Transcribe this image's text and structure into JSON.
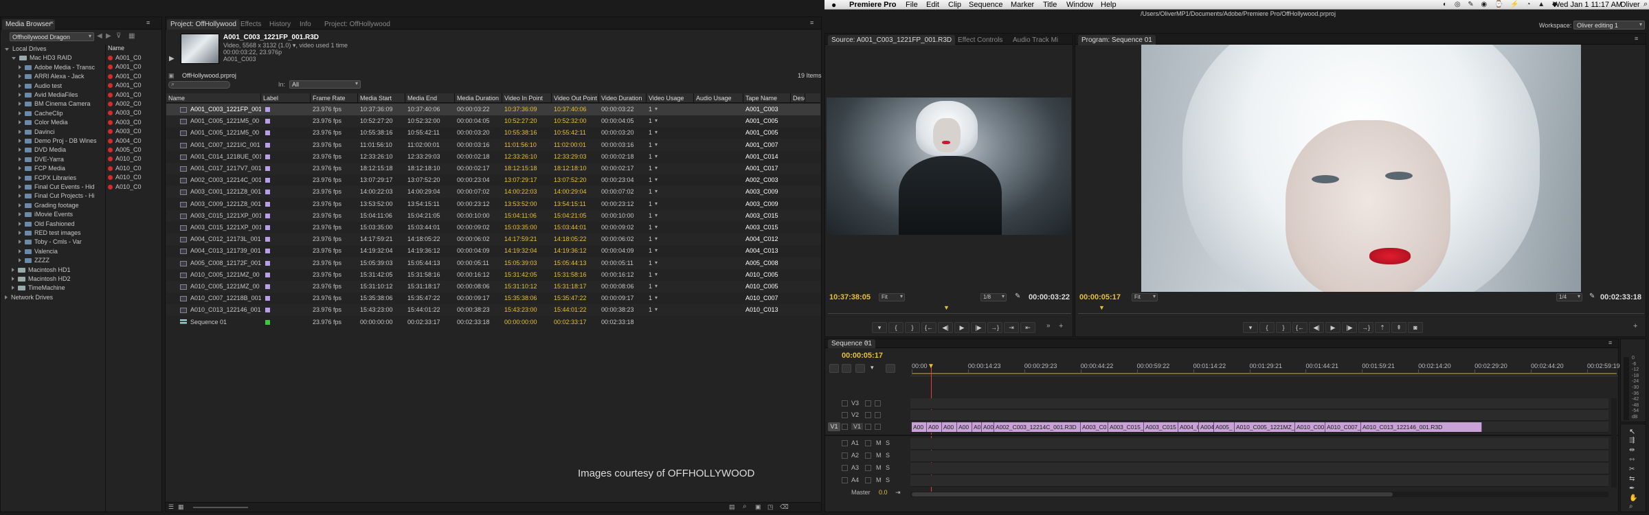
{
  "menubar": {
    "app_name": "Premiere Pro",
    "menus": [
      "File",
      "Edit",
      "Clip",
      "Sequence",
      "Marker",
      "Title",
      "Window",
      "Help"
    ],
    "clock": "Wed Jan 1  11:17 AM",
    "user": "Oliver",
    "path": "/Users/OliverMP1/Documents/Adobe/Premiere Pro/OffHollywood.prproj"
  },
  "workspace": {
    "label": "Workspace:",
    "value": "Oliver editing 1"
  },
  "media_browser": {
    "tab": "Media Browser",
    "location": "Offhollywood Dragon",
    "name_header": "Name",
    "tree": [
      {
        "label": "Local Drives",
        "type": "root",
        "level": 0,
        "open": true
      },
      {
        "label": "Mac HD3 RAID",
        "type": "drive",
        "level": 1,
        "open": true
      },
      {
        "label": "Adobe Media - Transc",
        "type": "folder",
        "level": 2
      },
      {
        "label": "ARRI Alexa - Jack",
        "type": "folder",
        "level": 2
      },
      {
        "label": "Audio test",
        "type": "folder",
        "level": 2
      },
      {
        "label": "Avid MediaFiles",
        "type": "folder",
        "level": 2
      },
      {
        "label": "BM Cinema Camera",
        "type": "folder",
        "level": 2
      },
      {
        "label": "CacheClip",
        "type": "folder",
        "level": 2
      },
      {
        "label": "Color Media",
        "type": "folder",
        "level": 2
      },
      {
        "label": "Davinci",
        "type": "folder",
        "level": 2
      },
      {
        "label": "Demo Proj - DB Wines",
        "type": "folder",
        "level": 2
      },
      {
        "label": "DVD Media",
        "type": "folder",
        "level": 2
      },
      {
        "label": "DVE-Yarra",
        "type": "folder",
        "level": 2
      },
      {
        "label": "FCP Media",
        "type": "folder",
        "level": 2
      },
      {
        "label": "FCPX Libraries",
        "type": "folder",
        "level": 2
      },
      {
        "label": "Final Cut Events - Hid",
        "type": "folder",
        "level": 2
      },
      {
        "label": "Final Cut Projects - Hi",
        "type": "folder",
        "level": 2
      },
      {
        "label": "Grading footage",
        "type": "folder",
        "level": 2
      },
      {
        "label": "iMovie Events",
        "type": "folder",
        "level": 2
      },
      {
        "label": "Old Fashioned",
        "type": "folder",
        "level": 2
      },
      {
        "label": "RED test images",
        "type": "folder",
        "level": 2
      },
      {
        "label": "Toby - Cmls - Var",
        "type": "folder",
        "level": 2
      },
      {
        "label": "Valencia",
        "type": "folder",
        "level": 2
      },
      {
        "label": "ZZZZ",
        "type": "folder",
        "level": 2
      },
      {
        "label": "Macintosh HD1",
        "type": "drive",
        "level": 1
      },
      {
        "label": "Macintosh HD2",
        "type": "drive",
        "level": 1
      },
      {
        "label": "TimeMachine",
        "type": "drive",
        "level": 1
      },
      {
        "label": "Network Drives",
        "type": "root",
        "level": 0
      }
    ],
    "files": [
      "A001_C0",
      "A001_C0",
      "A001_C0",
      "A001_C0",
      "A001_C0",
      "A002_C0",
      "A003_C0",
      "A003_C0",
      "A003_C0",
      "A004_C0",
      "A005_C0",
      "A010_C0",
      "A010_C0",
      "A010_C0",
      "A010_C0"
    ]
  },
  "project": {
    "tabs": [
      "Project: OffHollywood",
      "Effects",
      "History",
      "Info",
      "Project: OffHollywood"
    ],
    "clip_name": "A001_C003_1221FP_001.R3D",
    "clip_info1": "Video, 5568 x 3132 (1.0)",
    "clip_info1b": ", video used 1 time",
    "clip_info2": "00:00:03:22, 23.976p",
    "clip_info3": "A001_C003",
    "project_file": "OffHollywood.prproj",
    "item_count": "19 Items",
    "in_label": "In:",
    "in_value": "All",
    "columns": [
      "Name",
      "Label",
      "Frame Rate",
      "Media Start",
      "Media End",
      "Media Duration",
      "Video In Point",
      "Video Out Point",
      "Video Duration",
      "Video Usage",
      "Audio Usage",
      "Tape Name",
      "Desc"
    ],
    "rows": [
      {
        "name": "A001_C003_1221FP_001",
        "label": "#b9a0e6",
        "rate": "23.976 fps",
        "mstart": "10:37:36:09",
        "mend": "10:37:40:06",
        "mdur": "00:00:03:22",
        "vin": "10:37:36:09",
        "vout": "10:37:40:06",
        "vdur": "00:00:03:22",
        "usage": "1",
        "tape": "A001_C003"
      },
      {
        "name": "A001_C005_1221M5_00",
        "label": "#b9a0e6",
        "rate": "23.976 fps",
        "mstart": "10:52:27:20",
        "mend": "10:52:32:00",
        "mdur": "00:00:04:05",
        "vin": "10:52:27:20",
        "vout": "10:52:32:00",
        "vdur": "00:00:04:05",
        "usage": "1",
        "tape": "A001_C005"
      },
      {
        "name": "A001_C005_1221M5_00",
        "label": "#b9a0e6",
        "rate": "23.976 fps",
        "mstart": "10:55:38:16",
        "mend": "10:55:42:11",
        "mdur": "00:00:03:20",
        "vin": "10:55:38:16",
        "vout": "10:55:42:11",
        "vdur": "00:00:03:20",
        "usage": "1",
        "tape": "A001_C005"
      },
      {
        "name": "A001_C007_1221IC_001",
        "label": "#b9a0e6",
        "rate": "23.976 fps",
        "mstart": "11:01:56:10",
        "mend": "11:02:00:01",
        "mdur": "00:00:03:16",
        "vin": "11:01:56:10",
        "vout": "11:02:00:01",
        "vdur": "00:00:03:16",
        "usage": "1",
        "tape": "A001_C007"
      },
      {
        "name": "A001_C014_1218UE_001",
        "label": "#b9a0e6",
        "rate": "23.976 fps",
        "mstart": "12:33:26:10",
        "mend": "12:33:29:03",
        "mdur": "00:00:02:18",
        "vin": "12:33:26:10",
        "vout": "12:33:29:03",
        "vdur": "00:00:02:18",
        "usage": "1",
        "tape": "A001_C014"
      },
      {
        "name": "A001_C017_1217V7_001",
        "label": "#b9a0e6",
        "rate": "23.976 fps",
        "mstart": "18:12:15:18",
        "mend": "18:12:18:10",
        "mdur": "00:00:02:17",
        "vin": "18:12:15:18",
        "vout": "18:12:18:10",
        "vdur": "00:00:02:17",
        "usage": "1",
        "tape": "A001_C017"
      },
      {
        "name": "A002_C003_12214C_001",
        "label": "#b9a0e6",
        "rate": "23.976 fps",
        "mstart": "13:07:29:17",
        "mend": "13:07:52:20",
        "mdur": "00:00:23:04",
        "vin": "13:07:29:17",
        "vout": "13:07:52:20",
        "vdur": "00:00:23:04",
        "usage": "1",
        "tape": "A002_C003"
      },
      {
        "name": "A003_C001_1221Z8_001",
        "label": "#b9a0e6",
        "rate": "23.976 fps",
        "mstart": "14:00:22:03",
        "mend": "14:00:29:04",
        "mdur": "00:00:07:02",
        "vin": "14:00:22:03",
        "vout": "14:00:29:04",
        "vdur": "00:00:07:02",
        "usage": "1",
        "tape": "A003_C009"
      },
      {
        "name": "A003_C009_1221Z8_001",
        "label": "#b9a0e6",
        "rate": "23.976 fps",
        "mstart": "13:53:52:00",
        "mend": "13:54:15:11",
        "mdur": "00:00:23:12",
        "vin": "13:53:52:00",
        "vout": "13:54:15:11",
        "vdur": "00:00:23:12",
        "usage": "1",
        "tape": "A003_C009"
      },
      {
        "name": "A003_C015_1221XP_001",
        "label": "#b9a0e6",
        "rate": "23.976 fps",
        "mstart": "15:04:11:06",
        "mend": "15:04:21:05",
        "mdur": "00:00:10:00",
        "vin": "15:04:11:06",
        "vout": "15:04:21:05",
        "vdur": "00:00:10:00",
        "usage": "1",
        "tape": "A003_C015"
      },
      {
        "name": "A003_C015_1221XP_001",
        "label": "#b9a0e6",
        "rate": "23.976 fps",
        "mstart": "15:03:35:00",
        "mend": "15:03:44:01",
        "mdur": "00:00:09:02",
        "vin": "15:03:35:00",
        "vout": "15:03:44:01",
        "vdur": "00:00:09:02",
        "usage": "1",
        "tape": "A003_C015"
      },
      {
        "name": "A004_C012_12173L_001",
        "label": "#b9a0e6",
        "rate": "23.976 fps",
        "mstart": "14:17:59:21",
        "mend": "14:18:05:22",
        "mdur": "00:00:06:02",
        "vin": "14:17:59:21",
        "vout": "14:18:05:22",
        "vdur": "00:00:06:02",
        "usage": "1",
        "tape": "A004_C012"
      },
      {
        "name": "A004_C013_121739_001",
        "label": "#b9a0e6",
        "rate": "23.976 fps",
        "mstart": "14:19:32:04",
        "mend": "14:19:36:12",
        "mdur": "00:00:04:09",
        "vin": "14:19:32:04",
        "vout": "14:19:36:12",
        "vdur": "00:00:04:09",
        "usage": "1",
        "tape": "A004_C013"
      },
      {
        "name": "A005_C008_12172F_001",
        "label": "#b9a0e6",
        "rate": "23.976 fps",
        "mstart": "15:05:39:03",
        "mend": "15:05:44:13",
        "mdur": "00:00:05:11",
        "vin": "15:05:39:03",
        "vout": "15:05:44:13",
        "vdur": "00:00:05:11",
        "usage": "1",
        "tape": "A005_C008"
      },
      {
        "name": "A010_C005_1221MZ_00",
        "label": "#b9a0e6",
        "rate": "23.976 fps",
        "mstart": "15:31:42:05",
        "mend": "15:31:58:16",
        "mdur": "00:00:16:12",
        "vin": "15:31:42:05",
        "vout": "15:31:58:16",
        "vdur": "00:00:16:12",
        "usage": "1",
        "tape": "A010_C005"
      },
      {
        "name": "A010_C005_1221MZ_00",
        "label": "#b9a0e6",
        "rate": "23.976 fps",
        "mstart": "15:31:10:12",
        "mend": "15:31:18:17",
        "mdur": "00:00:08:06",
        "vin": "15:31:10:12",
        "vout": "15:31:18:17",
        "vdur": "00:00:08:06",
        "usage": "1",
        "tape": "A010_C005"
      },
      {
        "name": "A010_C007_12218B_001.",
        "label": "#b9a0e6",
        "rate": "23.976 fps",
        "mstart": "15:35:38:06",
        "mend": "15:35:47:22",
        "mdur": "00:00:09:17",
        "vin": "15:35:38:06",
        "vout": "15:35:47:22",
        "vdur": "00:00:09:17",
        "usage": "1",
        "tape": "A010_C007"
      },
      {
        "name": "A010_C013_122146_001",
        "label": "#b9a0e6",
        "rate": "23.976 fps",
        "mstart": "15:43:23:00",
        "mend": "15:44:01:22",
        "mdur": "00:00:38:23",
        "vin": "15:43:23:00",
        "vout": "15:44:01:22",
        "vdur": "00:00:38:23",
        "usage": "1",
        "tape": "A010_C013"
      },
      {
        "name": "Sequence 01",
        "label": "#3fc83f",
        "rate": "23.976 fps",
        "mstart": "00:00:00:00",
        "mend": "00:02:33:17",
        "mdur": "00:02:33:18",
        "vin": "00:00:00:00",
        "vout": "00:02:33:17",
        "vdur": "00:02:33:18",
        "usage": "",
        "tape": "",
        "sequence": true
      }
    ],
    "credit": "Images courtesy of OFFHOLLYWOOD"
  },
  "source_monitor": {
    "tabs": [
      "Source: A001_C003_1221FP_001.R3D",
      "Effect Controls",
      "Audio Track Mi"
    ],
    "timecode": "10:37:38:05",
    "fit": "Fit",
    "ratio": "1/8",
    "duration": "00:00:03:22"
  },
  "program_monitor": {
    "tab": "Program: Sequence 01",
    "timecode": "00:00:05:17",
    "fit": "Fit",
    "ratio": "1/4",
    "duration": "00:02:33:18"
  },
  "timeline": {
    "tab": "Sequence 01",
    "timecode": "00:00:05:17",
    "ruler": [
      "00:00",
      "00:00:14:23",
      "00:00:29:23",
      "00:00:44:22",
      "00:00:59:22",
      "00:01:14:22",
      "00:01:29:21",
      "00:01:44:21",
      "00:01:59:21",
      "00:02:14:20",
      "00:02:29:20",
      "00:02:44:20",
      "00:02:59:19"
    ],
    "video_tracks": [
      "V3",
      "V2",
      "V1"
    ],
    "audio_tracks": [
      "A1",
      "A2",
      "A3",
      "A4"
    ],
    "source_patch": "V1",
    "master_label": "Master",
    "master_value": "0.0",
    "clips": [
      "A00",
      "A00",
      "A00",
      "A00",
      "A0",
      "A00",
      "A002_C003_12214C_001.R3D",
      "A003_C0",
      "A003_C015_",
      "A003_C015",
      "A004_C",
      "A004",
      "A005_",
      "A010_C005_1221MZ_",
      "A010_C00",
      "A010_C007_",
      "A010_C013_122146_001.R3D"
    ],
    "meter_labels": [
      "0",
      "-6",
      "-12",
      "-18",
      "-24",
      "-30",
      "-36",
      "-42",
      "-48",
      "-54",
      "dB"
    ]
  },
  "colors": {
    "accent_yellow": "#e8c230",
    "clip_purple": "#c9a3d8",
    "playhead_red": "#e04040",
    "label_violet": "#b9a0e6",
    "label_green": "#3fc83f"
  }
}
